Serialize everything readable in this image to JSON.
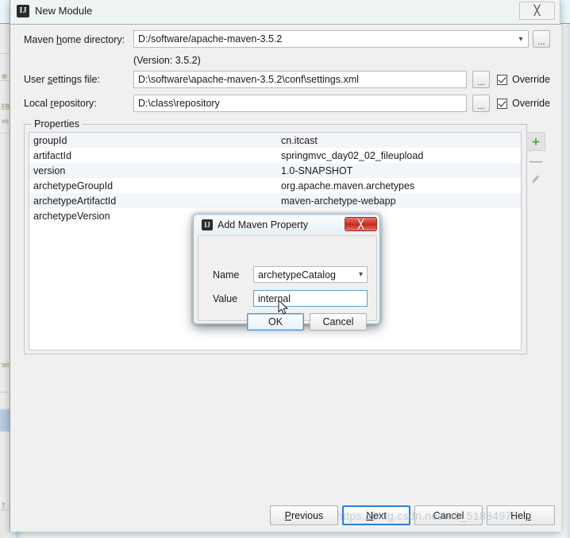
{
  "window": {
    "title": "New Module",
    "icon": "intellij-idea-icon",
    "close_label": "╳"
  },
  "form": {
    "maven_home": {
      "label_pre": "Maven ",
      "label_mnemonic": "h",
      "label_post": "ome directory:",
      "value": "D:/software/apache-maven-3.5.2",
      "browse_label": "...",
      "dropdown_icon": "chevron-down-icon"
    },
    "version_note": "(Version: 3.5.2)",
    "user_settings": {
      "label_pre": "User ",
      "label_mnemonic": "s",
      "label_post": "ettings file:",
      "value": "D:\\software\\apache-maven-3.5.2\\conf\\settings.xml",
      "browse_label": "...",
      "override_label": "Override",
      "override_checked": true
    },
    "local_repository": {
      "label_pre": "Local ",
      "label_mnemonic": "r",
      "label_post": "epository:",
      "value": "D:\\class\\repository",
      "browse_label": "...",
      "override_label": "Override",
      "override_checked": true
    }
  },
  "properties": {
    "group_title": "Properties",
    "rows": [
      {
        "name": "groupId",
        "value": "cn.itcast"
      },
      {
        "name": "artifactId",
        "value": "springmvc_day02_02_fileupload"
      },
      {
        "name": "version",
        "value": "1.0-SNAPSHOT"
      },
      {
        "name": "archetypeGroupId",
        "value": "org.apache.maven.archetypes"
      },
      {
        "name": "archetypeArtifactId",
        "value": "maven-archetype-webapp"
      },
      {
        "name": "archetypeVersion",
        "value": ""
      }
    ],
    "toolbar": {
      "add_label": "+",
      "remove_label": "—",
      "edit_icon": "pencil-icon",
      "add_color": "#46b04a"
    }
  },
  "add_property_dialog": {
    "title": "Add Maven Property",
    "icon": "intellij-idea-icon",
    "close_label": "╳",
    "name_label": "Name",
    "name_value": "archetypeCatalog",
    "name_dropdown_icon": "chevron-down-icon",
    "value_label": "Value",
    "value_value": "internal",
    "ok_label": "OK",
    "cancel_label": "Cancel"
  },
  "footer": {
    "previous_pre": "",
    "previous_mnemonic": "P",
    "previous_post": "revious",
    "next_pre": "",
    "next_mnemonic": "N",
    "next_post": "ext",
    "cancel_label": "Cancel",
    "help_pre": "Hel",
    "help_mnemonic": "p",
    "help_post": ""
  },
  "watermark": "https://blog.csdn.net/m0_51884972"
}
